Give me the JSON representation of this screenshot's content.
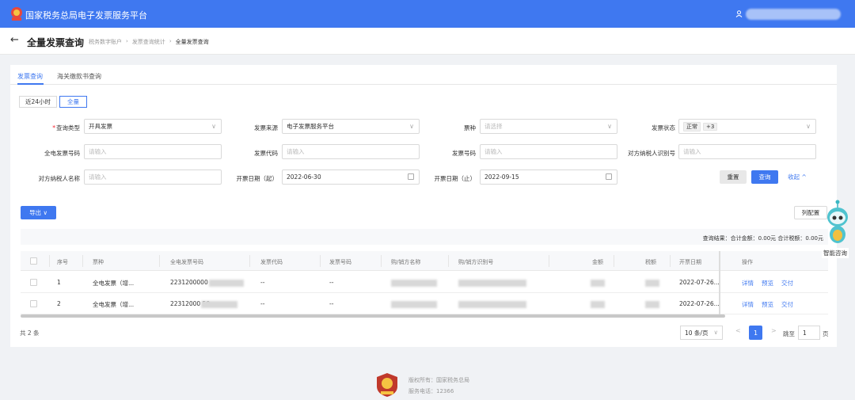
{
  "app": {
    "title": "国家税务总局电子发票服务平台"
  },
  "page": {
    "title": "全量发票查询",
    "breadcrumbs": [
      "税务数字账户",
      "发票查询统计",
      "全量发票查询"
    ]
  },
  "tabs": [
    "发票查询",
    "海关缴款书查询"
  ],
  "range_buttons": [
    "近24小时",
    "全量"
  ],
  "filters": {
    "query_type": {
      "label": "查询类型",
      "value": "开具发票"
    },
    "source": {
      "label": "发票来源",
      "value": "电子发票服务平台"
    },
    "ticket_kind": {
      "label": "票种",
      "placeholder": "请选择"
    },
    "status": {
      "label": "发票状态",
      "tag": "正常",
      "more": "+3"
    },
    "full_invoice_no": {
      "label": "全电发票号码",
      "placeholder": "请输入"
    },
    "invoice_code": {
      "label": "发票代码",
      "placeholder": "请输入"
    },
    "invoice_no": {
      "label": "发票号码",
      "placeholder": "请输入"
    },
    "counter_tax_id": {
      "label": "对方纳税人识别号",
      "placeholder": "请输入"
    },
    "counter_name": {
      "label": "对方纳税人名称",
      "placeholder": "请输入"
    },
    "date_start": {
      "label": "开票日期（起）",
      "value": "2022-06-30"
    },
    "date_end": {
      "label": "开票日期（止）",
      "value": "2022-09-15"
    }
  },
  "actions": {
    "reset": "重置",
    "search": "查询",
    "collapse": "收起 ^",
    "export": "导出 ∨",
    "columns": "列配置"
  },
  "summary": "查询结果：合计金额：0.00元   合计税额：0.00元",
  "table": {
    "headers": [
      "序号",
      "票种",
      "全电发票号码",
      "发票代码",
      "发票号码",
      "购/销方名称",
      "购/销方识别号",
      "金额",
      "税额",
      "开票日期",
      "操作"
    ],
    "rows": [
      {
        "seq": "1",
        "kind": "全电发票（增...",
        "number": "2231200000",
        "code": "--",
        "invno": "--",
        "date": "2022-07-26..."
      },
      {
        "seq": "2",
        "kind": "全电发票（增...",
        "number": "22312000              50",
        "code": "--",
        "invno": "--",
        "date": "2022-07-26..."
      }
    ],
    "ops": [
      "详情",
      "预览",
      "交付"
    ]
  },
  "pagination": {
    "total": "共 2 条",
    "page_size": "10 条/页",
    "current": "1",
    "prev": "<",
    "next": ">",
    "jump_label": "跳至",
    "jump_value": "1",
    "page_unit": "页"
  },
  "assistant": {
    "label": "智能咨询"
  },
  "footer": {
    "copyright": "版权所有：国家税务总局",
    "phone": "服务电话：12366"
  },
  "colors": {
    "primary": "#3f78f0",
    "topbar": "#3f78f0",
    "required": "#f5222d"
  }
}
